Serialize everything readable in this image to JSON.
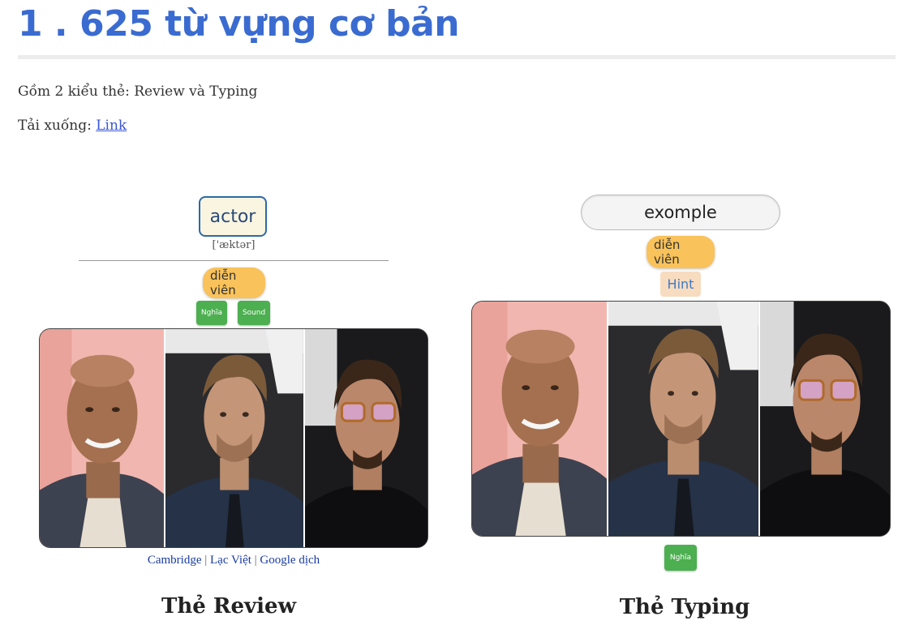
{
  "heading": "1 . 625 từ vựng cơ bản",
  "intro": "Gồm 2 kiểu thẻ: Review và Typing",
  "download": {
    "label": "Tải xuống: ",
    "link": "Link"
  },
  "review_card": {
    "word": "actor",
    "ipa": "['æktər]",
    "meaning": "diễn viên",
    "buttons": {
      "meaning": "Nghĩa",
      "sound": "Sound"
    },
    "dictionary_links": [
      "Cambridge",
      "Lạc Việt",
      "Google dịch"
    ],
    "separator": " | ",
    "caption": "Thẻ Review"
  },
  "typing_card": {
    "input_value": "exomple",
    "meaning": "diễn viên",
    "hint_label": "Hint",
    "meaning_button": "Nghĩa",
    "caption": "Thẻ Typing"
  },
  "colors": {
    "heading": "#3a6bd0",
    "meaning_pill": "#f9c25a",
    "green_button": "#4caf50",
    "hint_bg": "#f7dcc0",
    "link": "#1a3ba0"
  }
}
